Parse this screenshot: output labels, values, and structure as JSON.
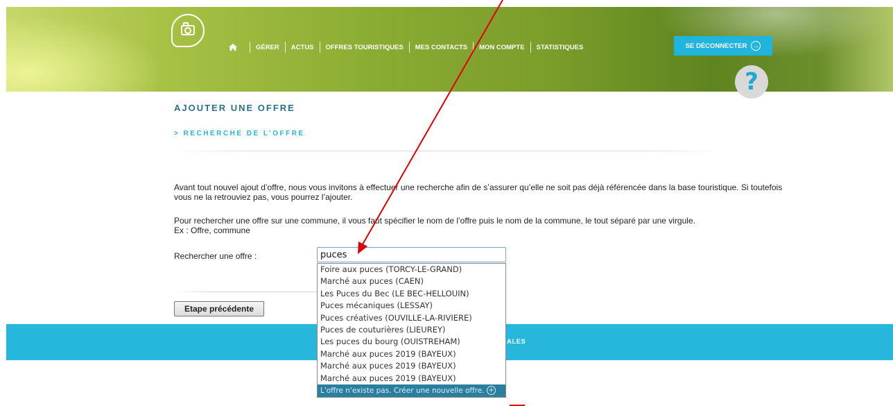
{
  "nav": {
    "items": [
      "GÉRER",
      "ACTUS",
      "OFFRES TOURISTIQUES",
      "MES CONTACTS",
      "MON COMPTE",
      "STATISTIQUES"
    ],
    "logout_label": "SE DÉCONNECTER",
    "help_symbol": "?"
  },
  "page": {
    "title": "AJOUTER UNE OFFRE",
    "subtitle": "> RECHERCHE DE L’OFFRE",
    "intro": "Avant tout nouvel ajout d’offre, nous vous invitons à effectuer une recherche afin de s’assurer qu’elle ne soit pas déjà référencée dans la base touristique. Si toutefois vous ne la retrouviez pas, vous pourrez l’ajouter.",
    "instructions": "Pour rechercher une offre sur une commune, il vous faut spécifier le nom de l’offre puis le nom de la commune, le tout séparé par une virgule.",
    "example": "Ex : Offre, commune"
  },
  "search": {
    "label": "Rechercher une offre :",
    "value": "puces",
    "suggestions": [
      "Foire aux puces (TORCY-LE-GRAND)",
      "Marché aux puces (CAEN)",
      "Les Puces du Bec (LE BEC-HELLOUIN)",
      "Puces mécaniques (LESSAY)",
      "Puces créatives (OUVILLE-LA-RIVIERE)",
      "Puces de couturières (LIEUREY)",
      "Les puces du bourg (OUISTREHAM)",
      "Marché aux puces 2019 (BAYEUX)",
      "Marché aux puces 2019 (BAYEUX)",
      "Marché aux puces 2019 (BAYEUX)"
    ],
    "create_label": "L'offre n'existe pas. Créer une nouvelle offre."
  },
  "buttons": {
    "previous": "Etape précédente"
  },
  "footer": {
    "partial_text": "ALES"
  },
  "colors": {
    "accent": "#27b7dc",
    "title": "#2a6f8c",
    "annotation": "#e00000"
  }
}
